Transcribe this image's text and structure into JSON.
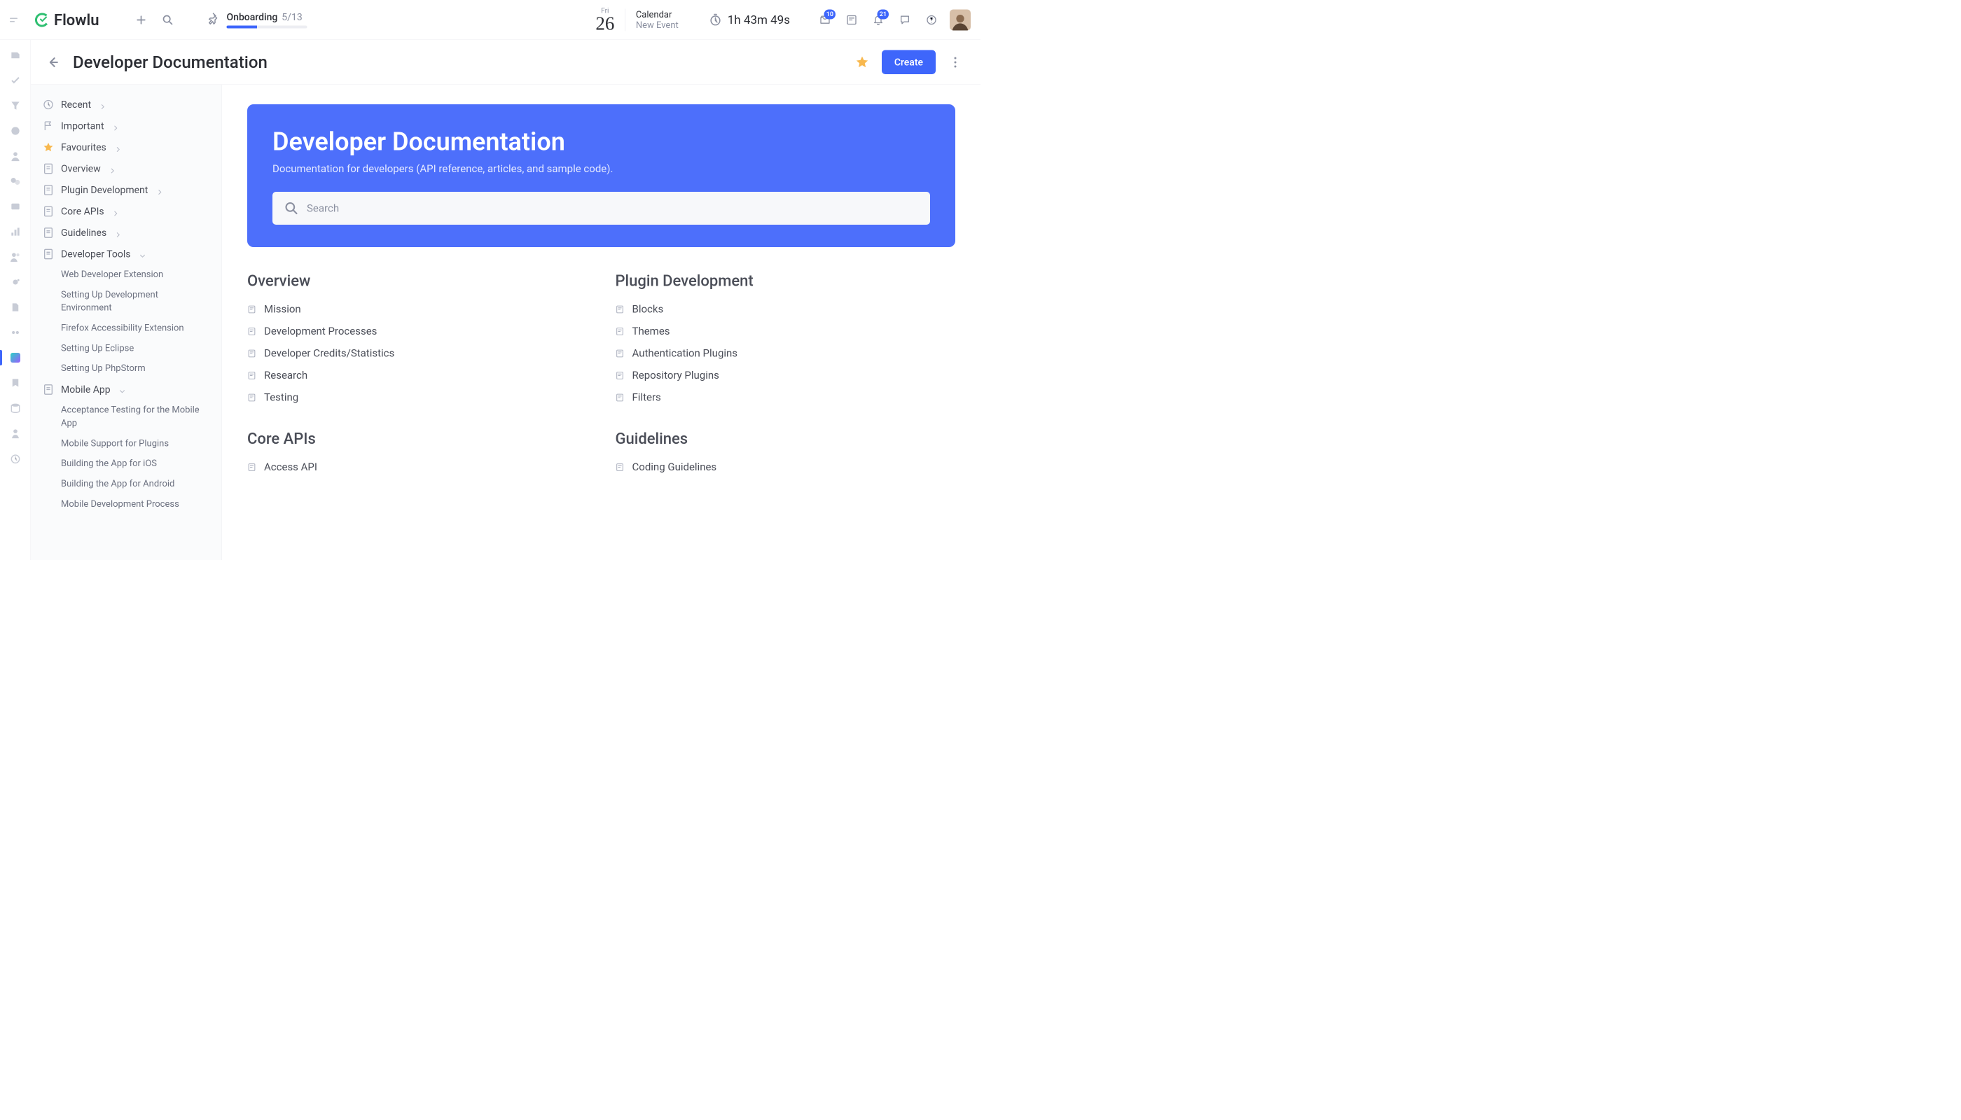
{
  "logo": "Flowlu",
  "onboarding": {
    "label": "Onboarding",
    "count": "5/13",
    "progress_pct": 38
  },
  "date": {
    "dow": "Fri",
    "day": "26"
  },
  "calendar": {
    "title": "Calendar",
    "subtitle": "New Event"
  },
  "timer": "1h 43m 49s",
  "badges": {
    "inbox": "10",
    "bell": "21"
  },
  "page_title": "Developer Documentation",
  "create_button": "Create",
  "sidenav": {
    "recent": "Recent",
    "important": "Important",
    "favourites": "Favourites",
    "overview": "Overview",
    "plugin_dev": "Plugin Development",
    "core_apis": "Core APIs",
    "guidelines": "Guidelines",
    "dev_tools": "Developer Tools",
    "dev_tools_children": [
      "Web Developer Extension",
      "Setting Up Development Environment",
      "Firefox Accessibility Extension",
      "Setting Up Eclipse",
      "Setting Up PhpStorm"
    ],
    "mobile_app": "Mobile App",
    "mobile_app_children": [
      "Acceptance Testing for the Mobile App",
      "Mobile Support for Plugins",
      "Building the App for iOS",
      "Building the App for Android",
      "Mobile Development Process"
    ]
  },
  "hero": {
    "title": "Developer Documentation",
    "subtitle": "Documentation for developers (API reference, articles, and sample code).",
    "search_placeholder": "Search"
  },
  "sections": [
    {
      "title": "Overview",
      "items": [
        "Mission",
        "Development Processes",
        "Developer Credits/Statistics",
        "Research",
        "Testing"
      ]
    },
    {
      "title": "Plugin Development",
      "items": [
        "Blocks",
        "Themes",
        "Authentication Plugins",
        "Repository Plugins",
        "Filters"
      ]
    },
    {
      "title": "Core APIs",
      "items": [
        "Access API"
      ]
    },
    {
      "title": "Guidelines",
      "items": [
        "Coding Guidelines"
      ]
    }
  ]
}
